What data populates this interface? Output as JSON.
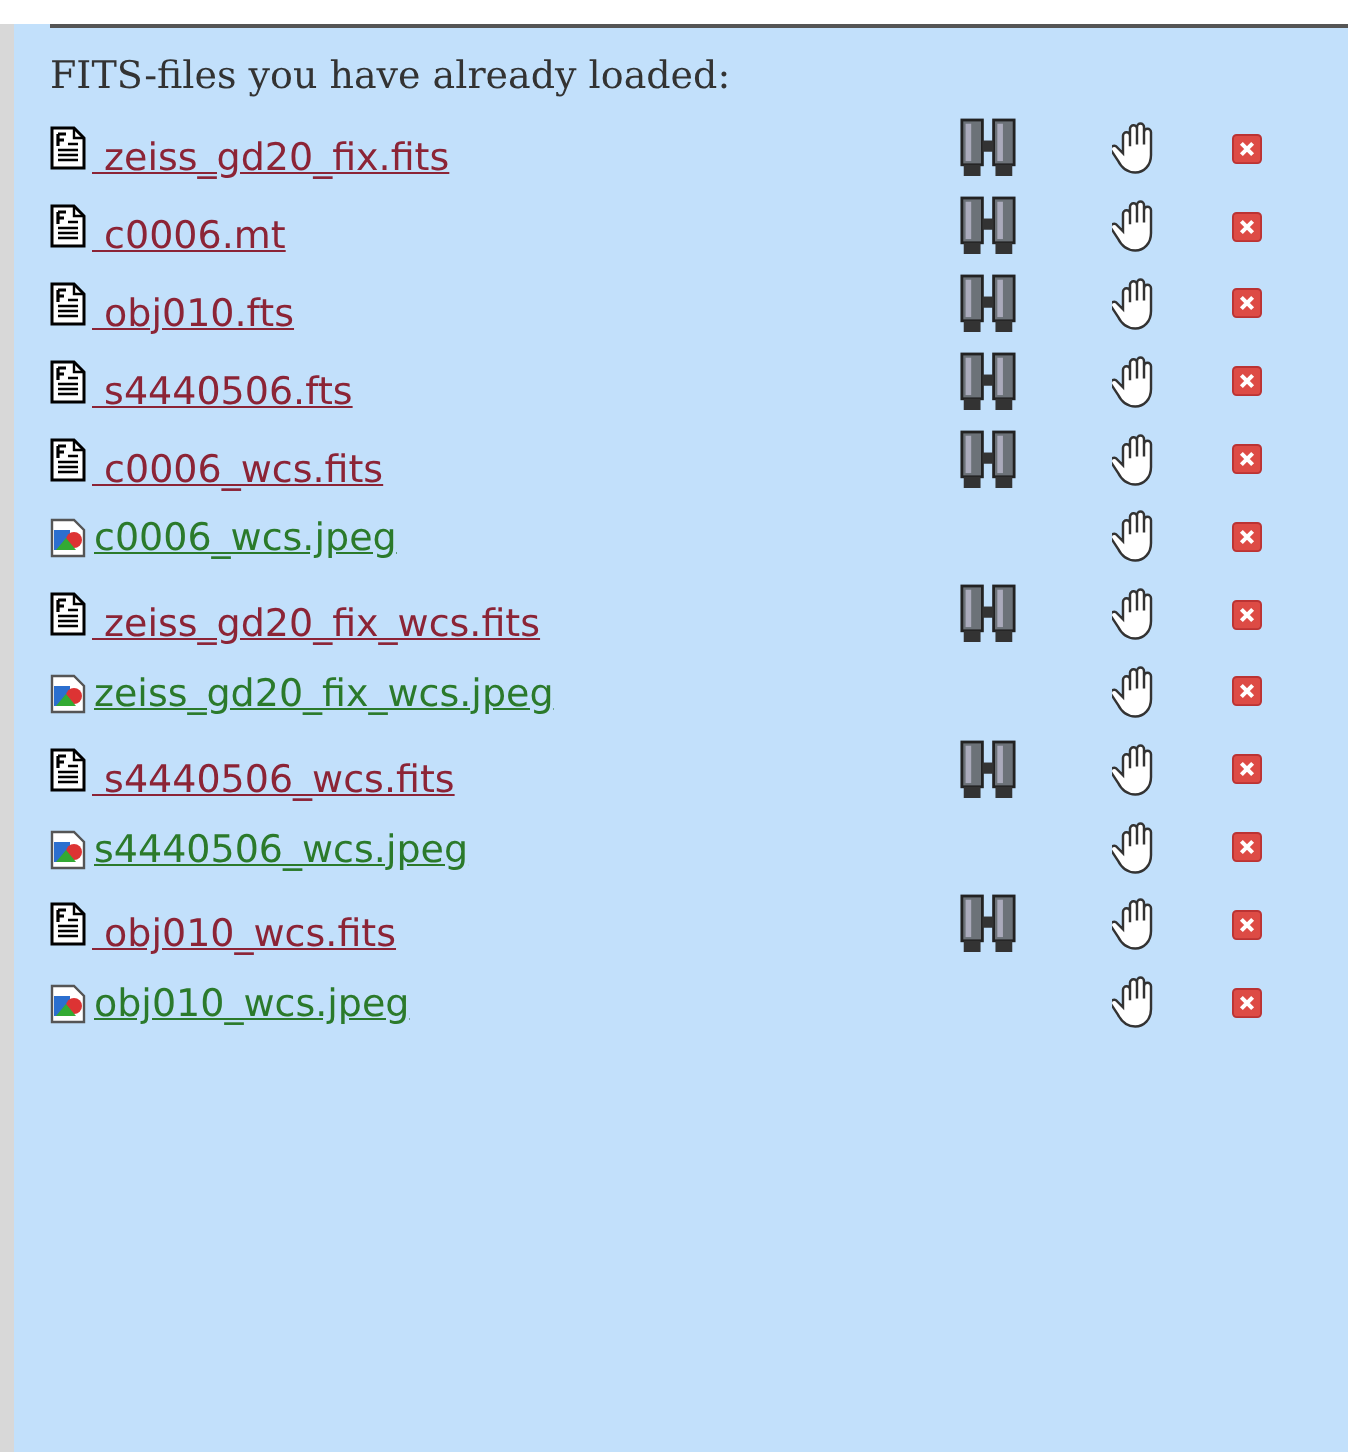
{
  "heading": "FITS-files you have already loaded:",
  "files": [
    {
      "name": " zeiss_gd20_fix.fits",
      "kind": "fits"
    },
    {
      "name": " c0006.mt",
      "kind": "fits"
    },
    {
      "name": " obj010.fts",
      "kind": "fits"
    },
    {
      "name": " s4440506.fts",
      "kind": "fits"
    },
    {
      "name": " c0006_wcs.fits",
      "kind": "fits"
    },
    {
      "name": "c0006_wcs.jpeg",
      "kind": "jpeg"
    },
    {
      "name": " zeiss_gd20_fix_wcs.fits",
      "kind": "fits"
    },
    {
      "name": "zeiss_gd20_fix_wcs.jpeg",
      "kind": "jpeg"
    },
    {
      "name": " s4440506_wcs.fits",
      "kind": "fits"
    },
    {
      "name": "s4440506_wcs.jpeg",
      "kind": "jpeg"
    },
    {
      "name": " obj010_wcs.fits",
      "kind": "fits"
    },
    {
      "name": "obj010_wcs.jpeg",
      "kind": "jpeg"
    }
  ]
}
